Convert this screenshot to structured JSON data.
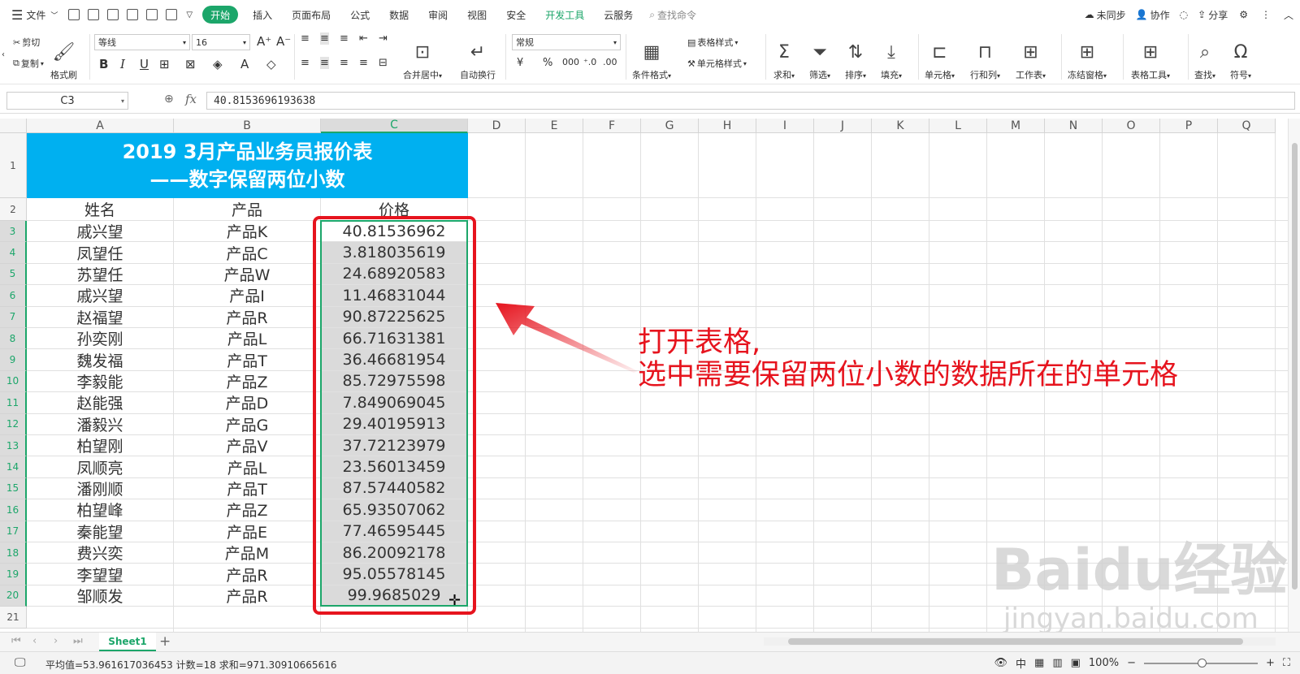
{
  "menubar": {
    "file_label": "文件",
    "tabs": [
      "开始",
      "插入",
      "页面布局",
      "公式",
      "数据",
      "审阅",
      "视图",
      "安全",
      "开发工具",
      "云服务"
    ],
    "search_label": "查找命令",
    "right": {
      "sync": "未同步",
      "collab": "协作",
      "share": "分享"
    }
  },
  "ribbon": {
    "cut": "剪切",
    "copy": "复制",
    "format_painter": "格式刷",
    "font_name": "等线",
    "font_size": "16",
    "merge_center": "合并居中",
    "auto_wrap": "自动换行",
    "number_format": "常规",
    "cond_format": "条件格式",
    "table_style": "表格样式",
    "cell_style": "单元格样式",
    "sum": "求和",
    "filter": "筛选",
    "sort": "排序",
    "fill": "填充",
    "cell": "单元格",
    "row_col": "行和列",
    "worksheet": "工作表",
    "freeze": "冻结窗格",
    "table_tools": "表格工具",
    "find": "查找",
    "symbol": "符号"
  },
  "formulabar": {
    "cell_ref": "C3",
    "fx": "fx",
    "value": "40.8153696193638"
  },
  "columns": [
    "A",
    "B",
    "C",
    "D",
    "E",
    "F",
    "G",
    "H",
    "I",
    "J",
    "K",
    "L",
    "M",
    "N",
    "O",
    "P",
    "Q"
  ],
  "rows": [
    "1",
    "2",
    "3",
    "4",
    "5",
    "6",
    "7",
    "8",
    "9",
    "10",
    "11",
    "12",
    "13",
    "14",
    "15",
    "16",
    "17",
    "18",
    "19",
    "20",
    "21"
  ],
  "sheet": {
    "title_line1": "2019 3月产品业务员报价表",
    "title_line2": "——数字保留两位小数",
    "headers": [
      "姓名",
      "产品",
      "价格"
    ],
    "data": [
      [
        "戚兴望",
        "产品K",
        "40.81536962"
      ],
      [
        "凤望任",
        "产品C",
        "3.818035619"
      ],
      [
        "苏望任",
        "产品W",
        "24.68920583"
      ],
      [
        "戚兴望",
        "产品I",
        "11.46831044"
      ],
      [
        "赵福望",
        "产品R",
        "90.87225625"
      ],
      [
        "孙奕刚",
        "产品L",
        "66.71631381"
      ],
      [
        "魏发福",
        "产品T",
        "36.46681954"
      ],
      [
        "李毅能",
        "产品Z",
        "85.72975598"
      ],
      [
        "赵能强",
        "产品D",
        "7.849069045"
      ],
      [
        "潘毅兴",
        "产品G",
        "29.40195913"
      ],
      [
        "柏望刚",
        "产品V",
        "37.72123979"
      ],
      [
        "凤顺亮",
        "产品L",
        "23.56013459"
      ],
      [
        "潘刚顺",
        "产品T",
        "87.57440582"
      ],
      [
        "柏望峰",
        "产品Z",
        "65.93507062"
      ],
      [
        "秦能望",
        "产品E",
        "77.46595445"
      ],
      [
        "费兴奕",
        "产品M",
        "86.20092178"
      ],
      [
        "李望望",
        "产品R",
        "95.05578145"
      ],
      [
        "邹顺发",
        "产品R",
        "99.9685029"
      ]
    ]
  },
  "annotation": {
    "line1": "打开表格,",
    "line2": "选中需要保留两位小数的数据所在的单元格"
  },
  "watermark": {
    "text": "Baidu经验",
    "url": "jingyan.baidu.com"
  },
  "sheet_tab": "Sheet1",
  "status": {
    "text": "平均值=53.961617036453  计数=18  求和=971.30910665616",
    "zoom": "100%"
  },
  "colors": {
    "accent": "#1ca66a",
    "title_bg": "#00b0f0",
    "annotation": "#e6141e"
  }
}
